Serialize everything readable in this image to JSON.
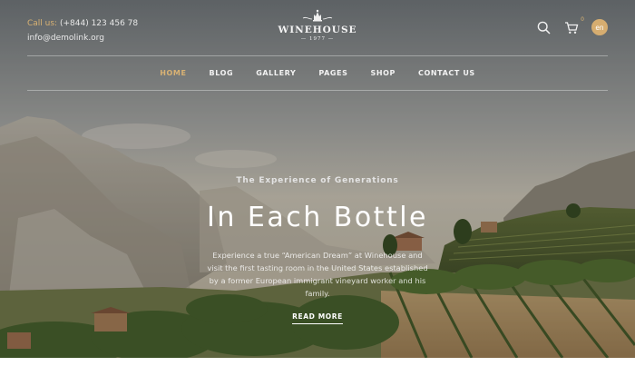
{
  "contact": {
    "label": "Call us:",
    "phone": "(+844) 123 456 78",
    "email": "info@demolink.org"
  },
  "logo": {
    "name": "WINEHOUSE",
    "year": "1977"
  },
  "header": {
    "cart_count": "0",
    "lang": "en",
    "icons": [
      "search-icon",
      "cart-icon"
    ]
  },
  "nav": [
    {
      "label": "HOME",
      "active": true
    },
    {
      "label": "BLOG",
      "active": false
    },
    {
      "label": "GALLERY",
      "active": false
    },
    {
      "label": "PAGES",
      "active": false
    },
    {
      "label": "SHOP",
      "active": false
    },
    {
      "label": "CONTACT US",
      "active": false
    }
  ],
  "hero": {
    "eyebrow": "The Experience of Generations",
    "title": "In Each Bottle",
    "description": "Experience a true “American Dream” at Winehouse and visit the first tasting room in the United States established by a former European immigrant vineyard worker and his family.",
    "cta": "READ MORE"
  },
  "colors": {
    "accent": "#d9b273",
    "lang_badge": "#d6ad70"
  }
}
